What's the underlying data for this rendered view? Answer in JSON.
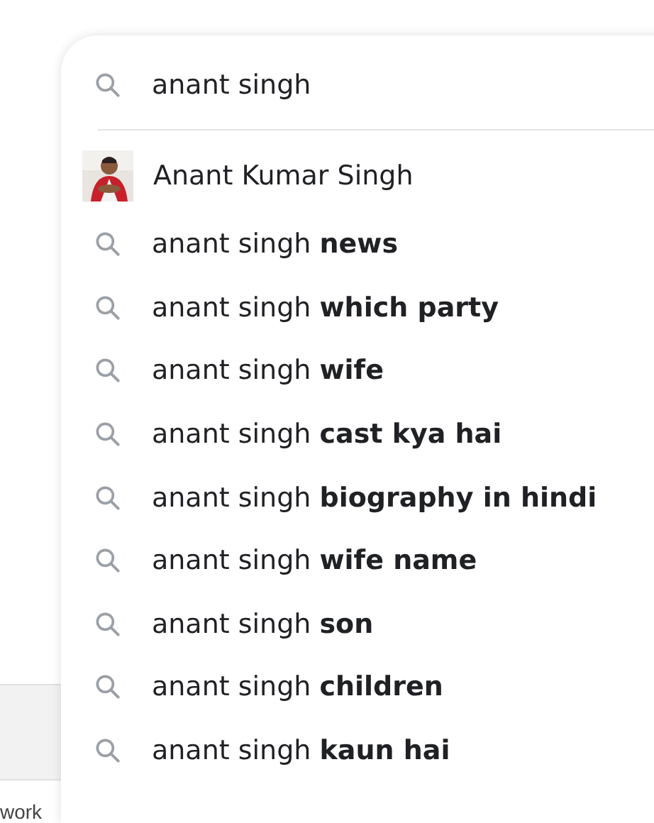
{
  "search": {
    "value": "anant singh"
  },
  "suggestions": [
    {
      "kind": "entity",
      "text": "Anant Kumar Singh"
    },
    {
      "kind": "query",
      "text": "anant singh **news**"
    },
    {
      "kind": "query",
      "text": "anant singh **which party**"
    },
    {
      "kind": "query",
      "text": "anant singh **wife**"
    },
    {
      "kind": "query",
      "text": "anant singh **cast kya hai**"
    },
    {
      "kind": "query",
      "text": "anant singh **biography in hindi**"
    },
    {
      "kind": "query",
      "text": "anant singh **wife name**"
    },
    {
      "kind": "query",
      "text": "anant singh **son**"
    },
    {
      "kind": "query",
      "text": "anant singh **children**"
    },
    {
      "kind": "query",
      "text": "anant singh **kaun hai**"
    }
  ],
  "background_text": "work"
}
